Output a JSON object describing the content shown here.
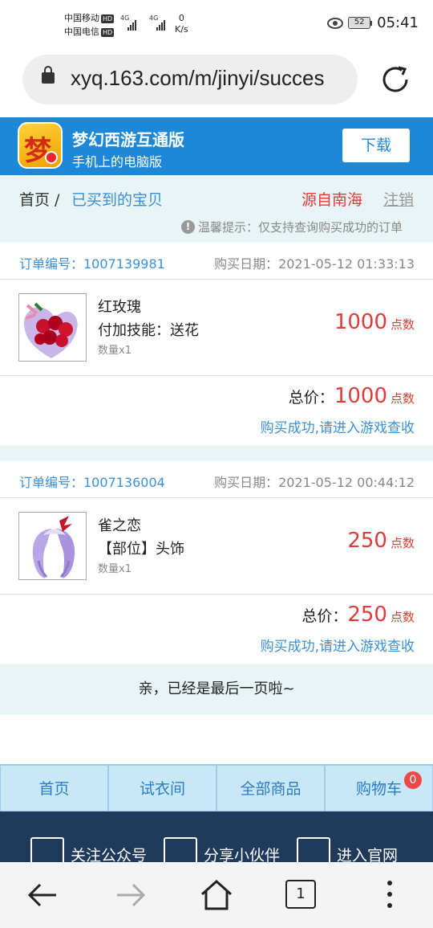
{
  "status_bar": {
    "carrier1": "中国移动",
    "carrier2": "中国电信",
    "hd": "HD",
    "net1": "4G",
    "net2": "4G",
    "speed_value": "0",
    "speed_unit": "K/s",
    "battery": "52",
    "time": "05:41"
  },
  "browser": {
    "url": "xyq.163.com/m/jinyi/succes"
  },
  "banner": {
    "logo_char": "梦",
    "title": "梦幻西游互通版",
    "subtitle": "手机上的电脑版",
    "download_label": "下载"
  },
  "breadcrumb": {
    "home": "首页 /",
    "current": "已买到的宝贝",
    "server": "源自南海",
    "logout": "注销",
    "tip": "温馨提示：仅支持查询购买成功的订单"
  },
  "orders": [
    {
      "order_no": "订单编号：1007139981",
      "date": "购买日期：2021-05-12 01:33:13",
      "name": "红玫瑰",
      "attr": "付加技能：送花",
      "qty": "数量x1",
      "price": "1000",
      "unit": "点数",
      "total_label": "总价：",
      "total": "1000",
      "status": "购买成功,请进入游戏查收"
    },
    {
      "order_no": "订单编号：1007136004",
      "date": "购买日期：2021-05-12 00:44:12",
      "name": "雀之恋",
      "attr": "【部位】头饰",
      "qty": "数量x1",
      "price": "250",
      "unit": "点数",
      "total_label": "总价：",
      "total": "250",
      "status": "购买成功,请进入游戏查收"
    }
  ],
  "last_page": "亲，已经是最后一页啦~",
  "tabs": [
    "首页",
    "试衣间",
    "全部商品",
    "购物车"
  ],
  "cart_count": "0",
  "footer_links": [
    "关注公众号",
    "分享小伙伴",
    "进入官网"
  ],
  "nav": {
    "tab_count": "1"
  }
}
